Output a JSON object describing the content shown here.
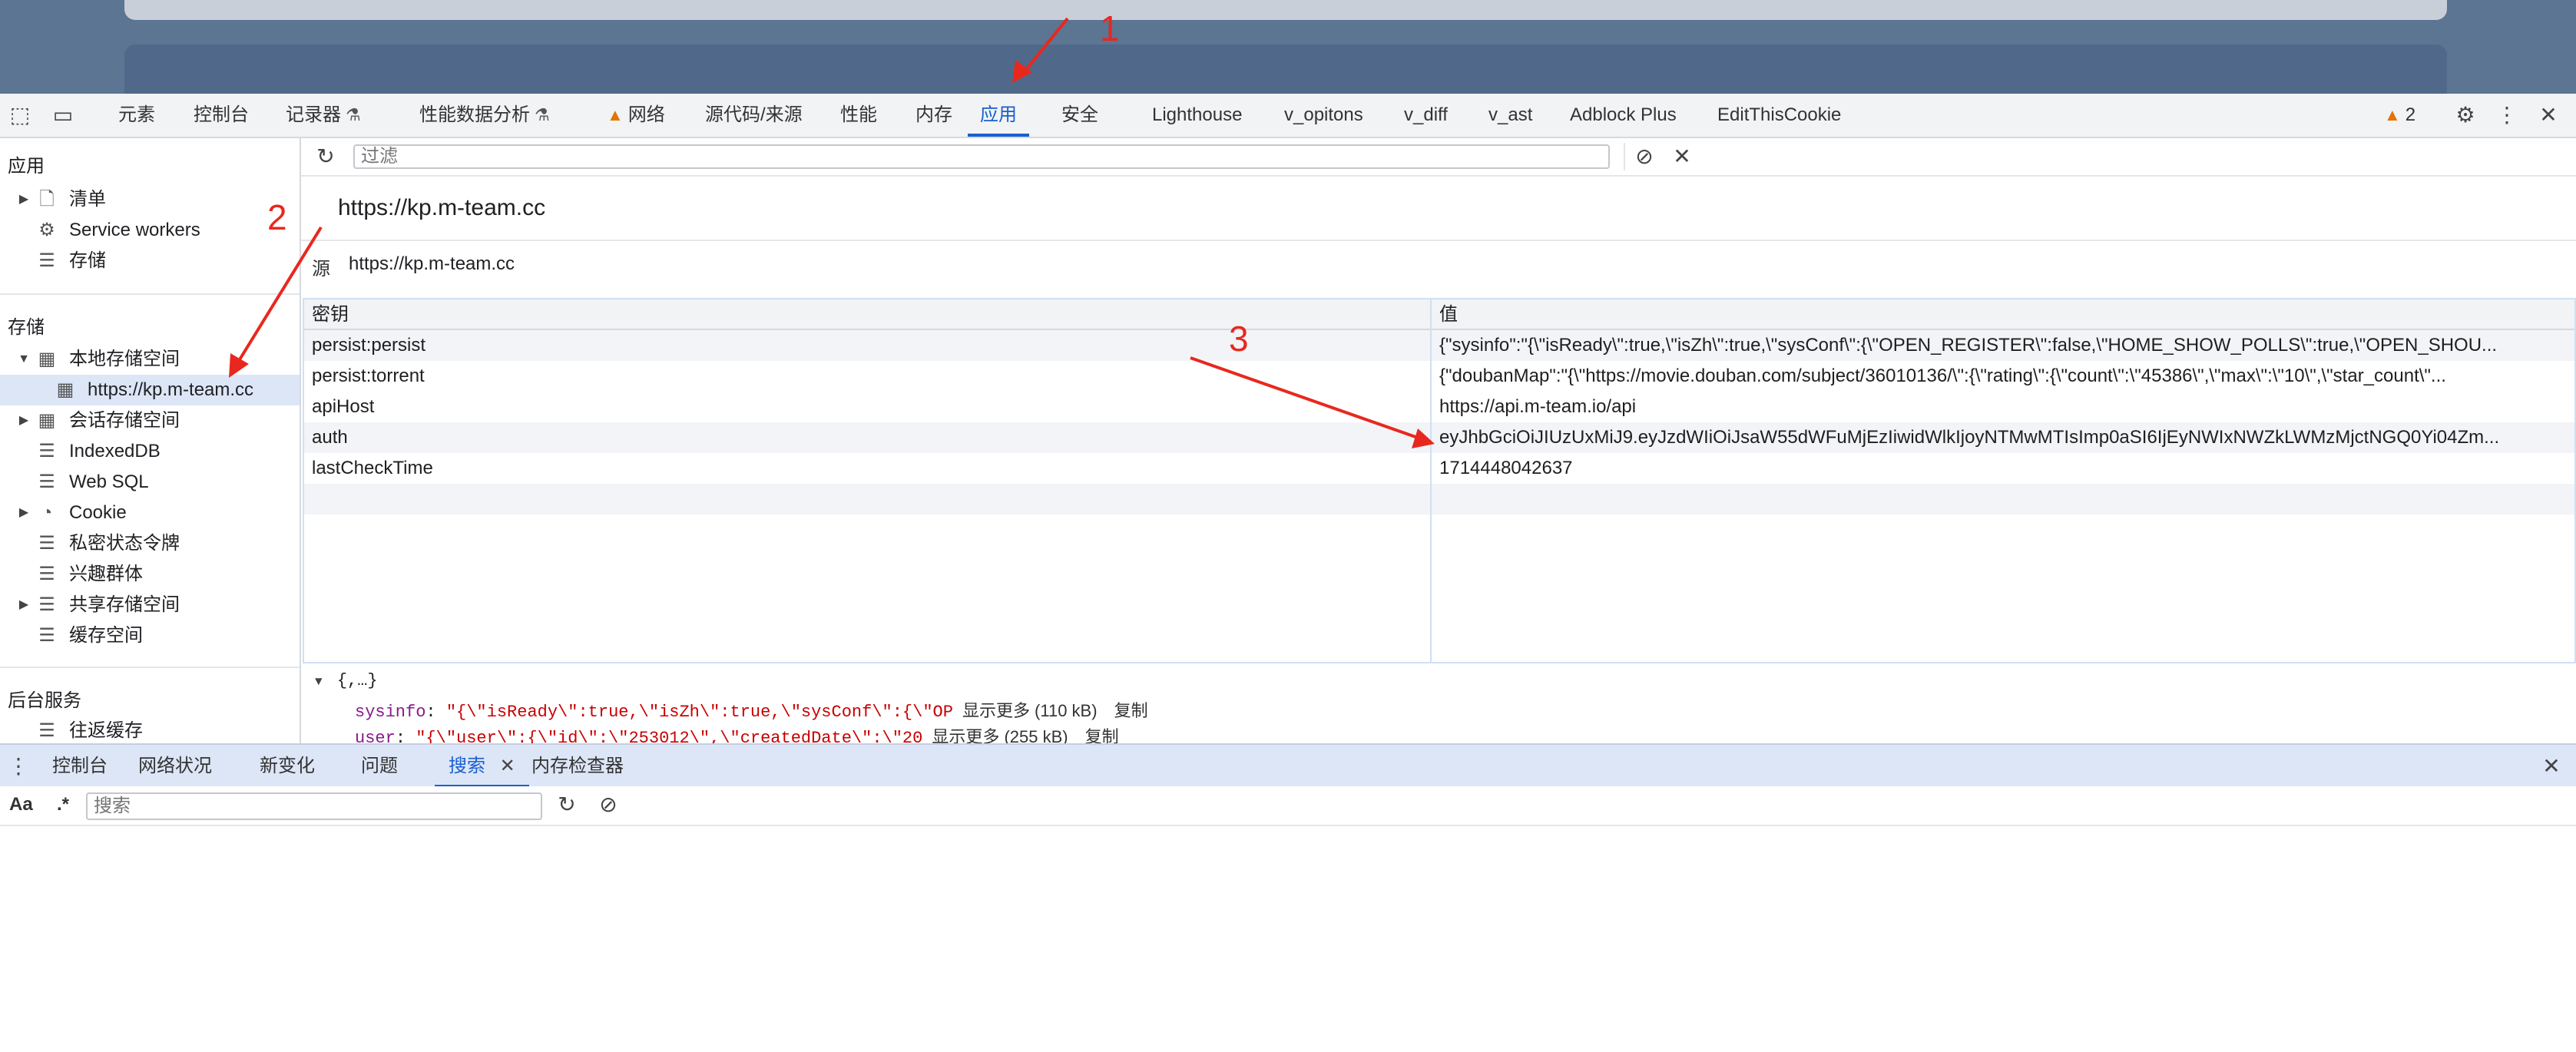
{
  "toolbar": {
    "tabs": [
      {
        "label": "元素"
      },
      {
        "label": "控制台"
      },
      {
        "label": "记录器"
      },
      {
        "label": "性能数据分析"
      },
      {
        "label": "网络"
      },
      {
        "label": "源代码/来源"
      },
      {
        "label": "性能"
      },
      {
        "label": "内存"
      },
      {
        "label": "应用"
      },
      {
        "label": "安全"
      },
      {
        "label": "Lighthouse"
      },
      {
        "label": "v_opitons"
      },
      {
        "label": "v_diff"
      },
      {
        "label": "v_ast"
      },
      {
        "label": "Adblock Plus"
      },
      {
        "label": "EditThisCookie"
      }
    ],
    "active_tab": "应用",
    "warning_count": "2"
  },
  "sidebar": {
    "app_section": {
      "title": "应用",
      "items": [
        {
          "label": "清单"
        },
        {
          "label": "Service workers"
        },
        {
          "label": "存储"
        }
      ]
    },
    "storage_section": {
      "title": "存储",
      "items": [
        {
          "label": "本地存储空间"
        },
        {
          "label": "https://kp.m-team.cc"
        },
        {
          "label": "会话存储空间"
        },
        {
          "label": "IndexedDB"
        },
        {
          "label": "Web SQL"
        },
        {
          "label": "Cookie"
        },
        {
          "label": "私密状态令牌"
        },
        {
          "label": "兴趣群体"
        },
        {
          "label": "共享存储空间"
        },
        {
          "label": "缓存空间"
        }
      ]
    },
    "backend_section": {
      "title": "后台服务",
      "items": [
        {
          "label": "往返缓存"
        }
      ]
    }
  },
  "filter": {
    "placeholder": "过滤"
  },
  "origin": {
    "title": "https://kp.m-team.cc",
    "label": "源",
    "value": "https://kp.m-team.cc"
  },
  "table": {
    "headers": {
      "key": "密钥",
      "value": "值"
    },
    "rows": [
      {
        "key": "persist:persist",
        "value": "{\"sysinfo\":\"{\\\"isReady\\\":true,\\\"isZh\\\":true,\\\"sysConf\\\":{\\\"OPEN_REGISTER\\\":false,\\\"HOME_SHOW_POLLS\\\":true,\\\"OPEN_SHOU..."
      },
      {
        "key": "persist:torrent",
        "value": "{\"doubanMap\":\"{\\\"https://movie.douban.com/subject/36010136/\\\":{\\\"rating\\\":{\\\"count\\\":\\\"45386\\\",\\\"max\\\":\\\"10\\\",\\\"star_count\\\"..."
      },
      {
        "key": "apiHost",
        "value": "https://api.m-team.io/api"
      },
      {
        "key": "auth",
        "value": "eyJhbGciOiJIUzUxMiJ9.eyJzdWIiOiJsaW55dWFuMjEzIiwidWlkIjoyNTMwMTIsImp0aSI6IjEyNWIxNWZkLWMzMjctNGQ0Yi04Zm..."
      },
      {
        "key": "lastCheckTime",
        "value": "1714448042637"
      }
    ]
  },
  "preview": {
    "root": "{,…}",
    "lines": [
      {
        "key": "sysinfo",
        "value": "\"{\\\"isReady\\\":true,\\\"isZh\\\":true,\\\"sysConf\\\":{\\\"OP",
        "more": "显示更多 (110 kB)",
        "copy": "复制"
      },
      {
        "key": "user",
        "value": "\"{\\\"user\\\":{\\\"id\\\":\\\"253012\\\",\\\"createdDate\\\":\\\"20",
        "more": "显示更多 (255 kB)",
        "copy": "复制"
      }
    ]
  },
  "drawer": {
    "tabs": [
      {
        "label": "控制台"
      },
      {
        "label": "网络状况"
      },
      {
        "label": "新变化"
      },
      {
        "label": "问题"
      },
      {
        "label": "搜索"
      },
      {
        "label": "内存检查器"
      }
    ],
    "active_tab": "搜索"
  },
  "search": {
    "case_label": "Aa",
    "regex_label": ".*",
    "placeholder": "搜索"
  },
  "annotations": {
    "n1": "1",
    "n2": "2",
    "n3": "3",
    "color": "#e8281f"
  },
  "colors": {
    "accent": "#1a5fd0",
    "selected_row": "#dde6f7",
    "warning": "#e37400"
  }
}
